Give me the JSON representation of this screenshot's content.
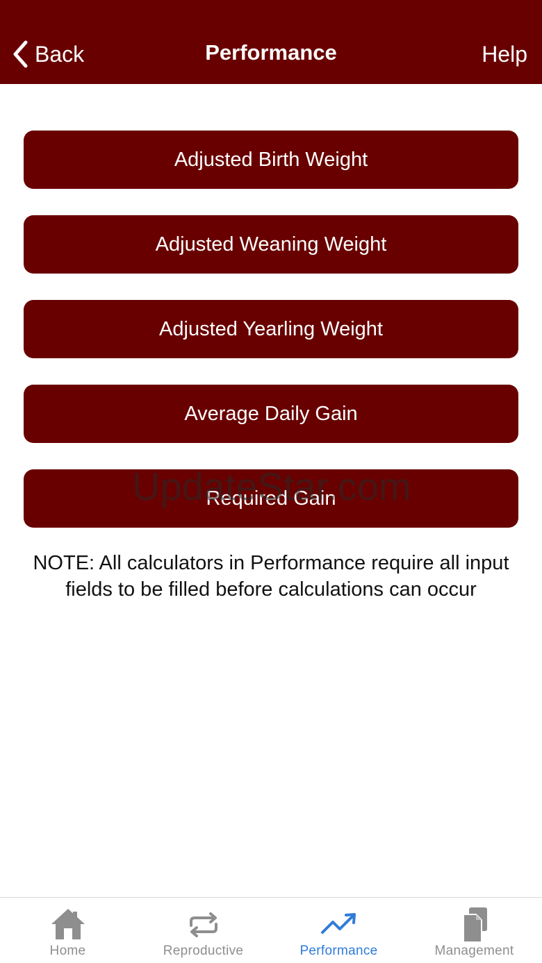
{
  "header": {
    "back_label": "Back",
    "title": "Performance",
    "help_label": "Help",
    "background_color": "#690000"
  },
  "calculators": [
    {
      "label": "Adjusted Birth Weight"
    },
    {
      "label": "Adjusted Weaning Weight"
    },
    {
      "label": "Adjusted Yearling Weight"
    },
    {
      "label": "Average Daily Gain"
    },
    {
      "label": "Required Gain"
    }
  ],
  "watermark": "UpdateStar.com",
  "note": "NOTE: All calculators in Performance require all input fields to be filled before calculations can occur",
  "tabbar": {
    "active_color": "#2f7bd9",
    "inactive_color": "#8e8e8e",
    "tabs": [
      {
        "label": "Home",
        "icon": "home-icon",
        "active": false
      },
      {
        "label": "Reproductive",
        "icon": "repeat-icon",
        "active": false
      },
      {
        "label": "Performance",
        "icon": "trending-up-icon",
        "active": true
      },
      {
        "label": "Management",
        "icon": "documents-icon",
        "active": false
      }
    ]
  }
}
